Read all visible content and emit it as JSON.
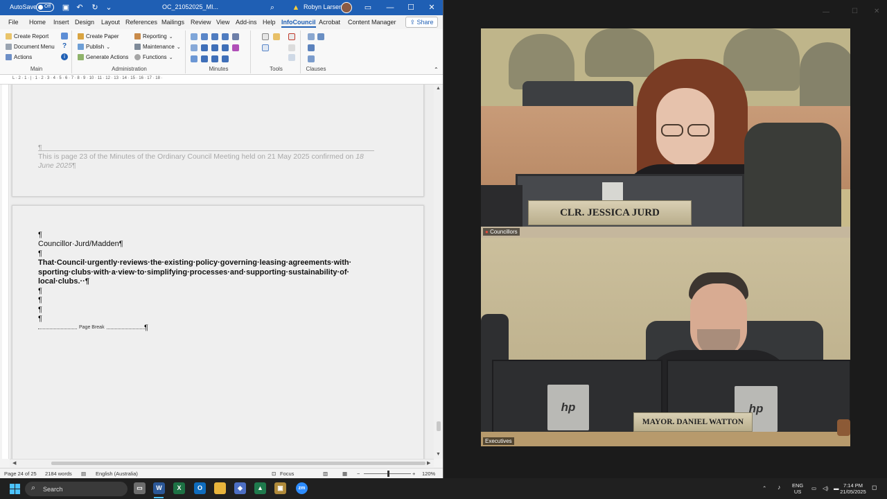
{
  "word": {
    "titlebar": {
      "autosave_label": "AutoSave",
      "autosave_state": "Off",
      "document_name": "OC_21052025_MI...",
      "user_name": "Robyn Larsen",
      "accent_color": "#1f5fb4"
    },
    "menu_tabs": [
      "File",
      "Home",
      "Insert",
      "Design",
      "Layout",
      "References",
      "Mailings",
      "Review",
      "View",
      "Add-ins",
      "Help",
      "InfoCouncil",
      "Acrobat",
      "Content Manager"
    ],
    "active_tab": "InfoCouncil",
    "share_label": "Share",
    "ribbon": {
      "main": {
        "name": "Main",
        "items": [
          "Create Report",
          "Document Menu",
          "Actions"
        ]
      },
      "administration": {
        "name": "Administration",
        "items": [
          "Create Paper",
          "Publish",
          "Generate Actions",
          "Reporting",
          "Maintenance",
          "Functions"
        ]
      },
      "minutes": {
        "name": "Minutes"
      },
      "tools": {
        "name": "Tools"
      },
      "clauses": {
        "name": "Clauses"
      }
    },
    "ruler_numbers": "L · 2 · 1 · | · 1 · 2 · 3 · 4 · 5 · 6 · 7 · 8 · 9 · 10 · 11 · 12 · 13 · 14 · 15 · 16 · 17 · 18 ·",
    "document": {
      "prev_page_pilcrow": "¶",
      "footer_line1": "This is page 23 of the Minutes of the Ordinary Council Meeting held on 21 May 2025 confirmed on ",
      "footer_date": "18",
      "footer_line2": "June 2025",
      "footer_end": "¶",
      "pilcrow": "¶",
      "mover": "Councillor·Jurd/Madden¶",
      "resolution_line1": "That·Council·urgently·reviews·the·existing·policy·governing·leasing·agreements·with·",
      "resolution_line2": "sporting·clubs·with·a·view·to·simplifying·processes·and·supporting·sustainability·of·",
      "resolution_line3": "local·clubs.··¶",
      "page_break_label": "Page Break",
      "page_break_pilcrow": "¶"
    },
    "status": {
      "page": "Page 24 of 25",
      "words": "2184 words",
      "language": "English (Australia)",
      "focus": "Focus",
      "zoom_minus": "−",
      "zoom_plus": "+",
      "zoom": "120%",
      "zoom_level_percent": 120
    }
  },
  "video": {
    "top_feed": {
      "label": "Councillors",
      "nameplate": "CLR. JESSICA JURD"
    },
    "bottom_feed": {
      "label": "Executives",
      "nameplate": "MAYOR. DANIEL WATTON",
      "monitor_logo": "hp"
    }
  },
  "taskbar": {
    "search_label": "Search",
    "zoom_icon_label": "zm",
    "language_line1": "ENG",
    "language_line2": "US",
    "time": "7:14 PM",
    "date": "21/05/2025"
  }
}
